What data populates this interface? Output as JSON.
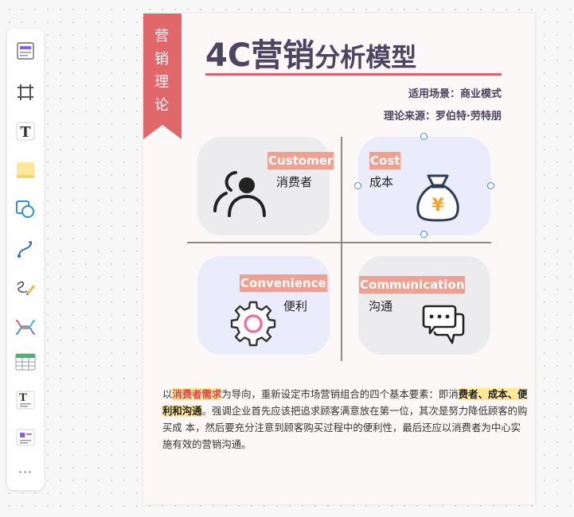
{
  "toolbar": {
    "tools": [
      {
        "id": "template",
        "icon": "template-icon"
      },
      {
        "id": "frame",
        "icon": "frame-icon"
      },
      {
        "id": "text",
        "icon": "text-icon",
        "glyph": "T"
      },
      {
        "id": "sticky",
        "icon": "sticky-note-icon"
      },
      {
        "id": "shape",
        "icon": "shape-icon"
      },
      {
        "id": "connector",
        "icon": "connector-icon"
      },
      {
        "id": "pen",
        "icon": "pen-icon"
      },
      {
        "id": "mindmap",
        "icon": "mindmap-icon"
      },
      {
        "id": "table",
        "icon": "table-icon"
      },
      {
        "id": "text-doc",
        "icon": "text-doc-icon",
        "glyph": "T"
      },
      {
        "id": "card",
        "icon": "card-icon"
      },
      {
        "id": "more",
        "icon": "more-icon",
        "glyph": "···"
      }
    ]
  },
  "page": {
    "ribbon": [
      "营",
      "销",
      "理",
      "论"
    ],
    "title_main": "4C营销",
    "title_rest": "分析模型",
    "meta_scene": "适用场景：商业模式",
    "meta_source": "理论来源：罗伯特·劳特朋",
    "quadrants": {
      "customer": {
        "en": "Customer",
        "cn": "消费者",
        "icon": "user-group-icon"
      },
      "cost": {
        "en": "Cost",
        "cn": "成本",
        "icon": "money-bag-icon",
        "glyph": "¥"
      },
      "convenience": {
        "en": "Convenience",
        "cn": "便利",
        "icon": "gear-icon"
      },
      "communication": {
        "en": "Communication",
        "cn": "沟通",
        "icon": "chat-bubbles-icon"
      }
    },
    "paragraph": {
      "p1": "以",
      "h1": "消费者需求",
      "p2": "为导向，重新设定市场营销组合的四个基本要素：即消",
      "h2": "费者、成本、便利和沟通",
      "p3": "。强调企业首先应该把追求顾客满意放在第一位，其次是努力降低顾客的购买成 本，然后要充分注意到顾客购买过程中的便利性，最后还应以消费者为中心实施有效的营销沟通。"
    }
  },
  "colors": {
    "ribbon": "#e0676a",
    "accent_line": "#d9636b",
    "label_bg": "#f0a090",
    "title": "#4a4560",
    "highlight": "#ffe79a",
    "highlight_text": "#e0424a",
    "selection": "#3f8bd9"
  }
}
